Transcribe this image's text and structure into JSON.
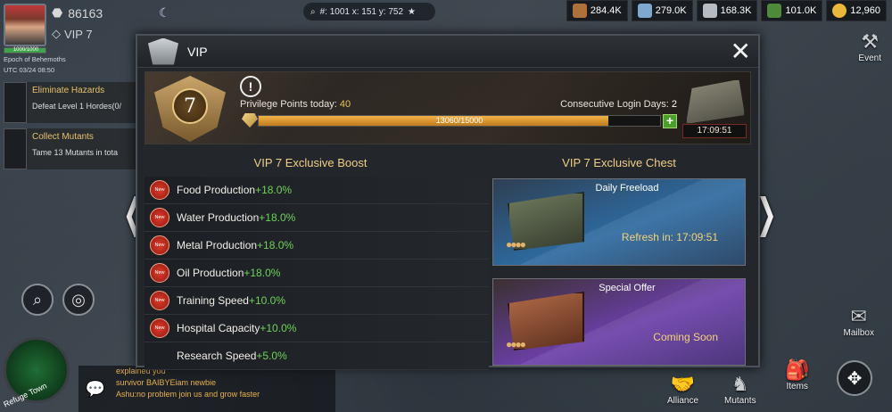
{
  "player": {
    "power": "86163",
    "hp": "1000/1000",
    "alliance_line": "Epoch of Behemoths",
    "utc": "UTC 03/24 08:50",
    "vip_label": "VIP 7"
  },
  "coords": {
    "text": "#: 1001 x: 151 y: 752"
  },
  "resources": [
    {
      "name": "food",
      "value": "284.4K",
      "color": "#b0703a"
    },
    {
      "name": "water",
      "value": "279.0K",
      "color": "#7fa8d0"
    },
    {
      "name": "metal",
      "value": "168.3K",
      "color": "#b7bcc2"
    },
    {
      "name": "oil",
      "value": "101.0K",
      "color": "#4f8a3a"
    },
    {
      "name": "gold",
      "value": "12,960",
      "color": "#e8b83a"
    }
  ],
  "quests": [
    {
      "title": "Eliminate Hazards",
      "desc": "Defeat Level 1 Hordes(0/"
    },
    {
      "title": "Collect Mutants",
      "desc": "Tame 13 Mutants in tota"
    }
  ],
  "chat": {
    "lines": [
      "explained you",
      "survivor BAIBYEiam newbie",
      "Ashu:no problem join us and grow faster"
    ]
  },
  "refuge_label": "Refuge Town",
  "side": {
    "event": "Event",
    "mailbox": "Mailbox",
    "alliance": "Alliance",
    "mutants": "Mutants",
    "items": "Items"
  },
  "dialog": {
    "title": "VIP",
    "vip_level": "7",
    "privilege_label": "Privilege Points today:",
    "privilege_value": "40",
    "login_label": "Consecutive Login Days:",
    "login_value": "2",
    "progress_text": "13060/15000",
    "progress_fraction": 0.8707,
    "chest_timer": "17:09:51",
    "boost_header": "VIP 7 Exclusive Boost",
    "chest_header": "VIP 7 Exclusive Chest",
    "boosts": [
      {
        "name": "Food Production",
        "value": "+18.0%",
        "new": true
      },
      {
        "name": "Water Production",
        "value": "+18.0%",
        "new": true
      },
      {
        "name": "Metal Production",
        "value": "+18.0%",
        "new": true
      },
      {
        "name": "Oil Production",
        "value": "+18.0%",
        "new": true
      },
      {
        "name": "Training Speed",
        "value": "+10.0%",
        "new": true
      },
      {
        "name": "Hospital Capacity",
        "value": "+10.0%",
        "new": true
      },
      {
        "name": "Research Speed",
        "value": "+5.0%",
        "new": false
      }
    ],
    "new_label": "New",
    "cards": [
      {
        "title": "Daily Freeload",
        "sub": "Refresh in: 17:09:51"
      },
      {
        "title": "Special Offer",
        "sub": "Coming Soon"
      }
    ]
  }
}
